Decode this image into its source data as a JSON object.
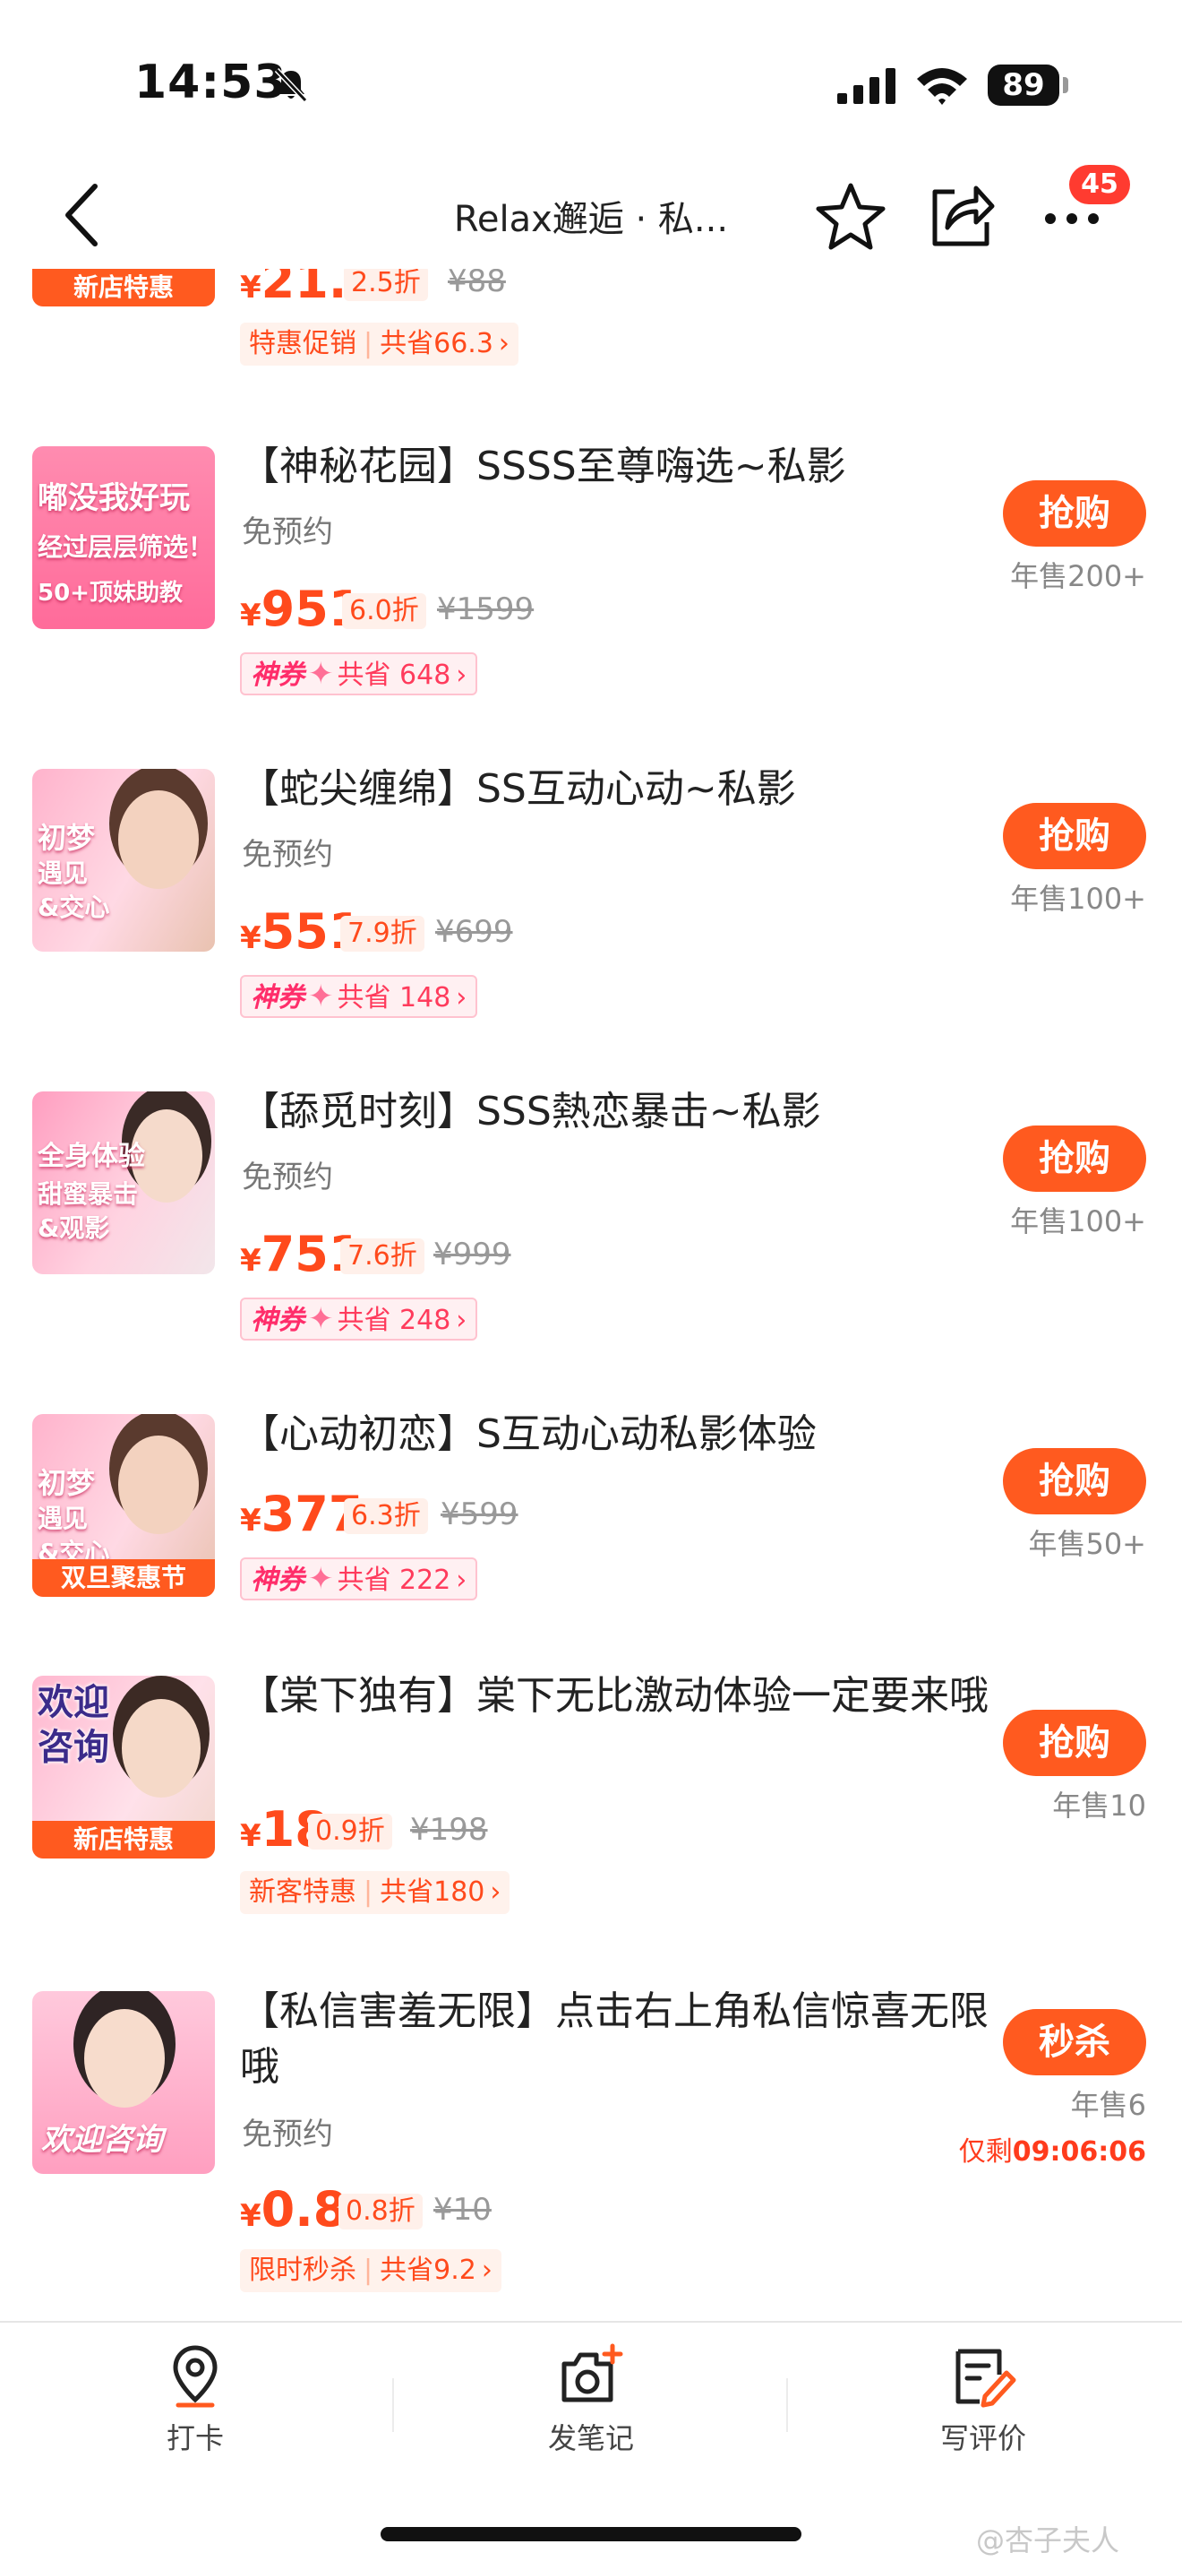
{
  "status_bar": {
    "time": "14:53",
    "battery": "89"
  },
  "header": {
    "title": "Relax邂逅 · 私...",
    "notification_count": "45"
  },
  "items": [
    {
      "thumb_tag": "新店特惠",
      "price": "21.7",
      "discount": "2.5折",
      "original_price": "¥88",
      "promo_label": "特惠促销",
      "savings": "共省66.3"
    },
    {
      "title": "【神秘花园】SSSS至尊嗨选~私影",
      "subtitle": "免预约",
      "thumb_lines": [
        "嘟没我好玩",
        "经过层层筛选！",
        "50+顶妹助教"
      ],
      "price": "951",
      "discount": "6.0折",
      "original_price": "¥1599",
      "promo_label": "神券",
      "savings": "共省 648",
      "button": "抢购",
      "sold": "年售200+"
    },
    {
      "title": "【蛇尖缠绵】SS互动心动~私影",
      "subtitle": "免预约",
      "thumb_lines": [
        "初梦",
        "遇见",
        "&交心"
      ],
      "price": "551",
      "discount": "7.9折",
      "original_price": "¥699",
      "promo_label": "神券",
      "savings": "共省 148",
      "button": "抢购",
      "sold": "年售100+"
    },
    {
      "title": "【舔觅时刻】SSS熱恋暴击~私影",
      "subtitle": "免预约",
      "thumb_lines": [
        "全身体验",
        "甜蜜暴击",
        "&观影"
      ],
      "price": "751",
      "discount": "7.6折",
      "original_price": "¥999",
      "promo_label": "神券",
      "savings": "共省 248",
      "button": "抢购",
      "sold": "年售100+"
    },
    {
      "title": "【心动初恋】S互动心动私影体验",
      "thumb_lines": [
        "初梦",
        "遇见",
        "&交心"
      ],
      "thumb_tag": "双旦聚惠节",
      "price": "377",
      "discount": "6.3折",
      "original_price": "¥599",
      "promo_label": "神券",
      "savings": "共省 222",
      "button": "抢购",
      "sold": "年售50+"
    },
    {
      "title": "【棠下独有】棠下无比激动体验一定要来哦",
      "thumb_lines": [
        "欢迎",
        "咨询"
      ],
      "thumb_tag": "新店特惠",
      "price": "18",
      "discount": "0.9折",
      "original_price": "¥198",
      "promo_label": "新客特惠",
      "savings": "共省180",
      "button": "抢购",
      "sold": "年售10"
    },
    {
      "title": "【私信害羞无限】点击右上角私信惊喜无限哦",
      "subtitle": "免预约",
      "thumb_lines": [
        "欢迎咨询"
      ],
      "price": "0.8",
      "discount": "0.8折",
      "original_price": "¥10",
      "promo_label": "限时秒杀",
      "savings": "共省9.2",
      "button": "秒杀",
      "sold": "年售6",
      "countdown_label": "仅剩",
      "countdown": "09:06:06"
    }
  ],
  "toolbar": {
    "checkin": "打卡",
    "post_note": "发笔记",
    "write_review": "写评价"
  },
  "watermark": "@杏子夫人",
  "colors": {
    "accent": "#ff5a1f",
    "price": "#ff4a1c",
    "coupon": "#ff2d6a"
  },
  "icons": [
    "bell-off-icon",
    "signal-icon",
    "wifi-icon",
    "back-icon",
    "star-icon",
    "share-icon",
    "more-icon",
    "location-pin-icon",
    "camera-plus-icon",
    "edit-review-icon"
  ]
}
